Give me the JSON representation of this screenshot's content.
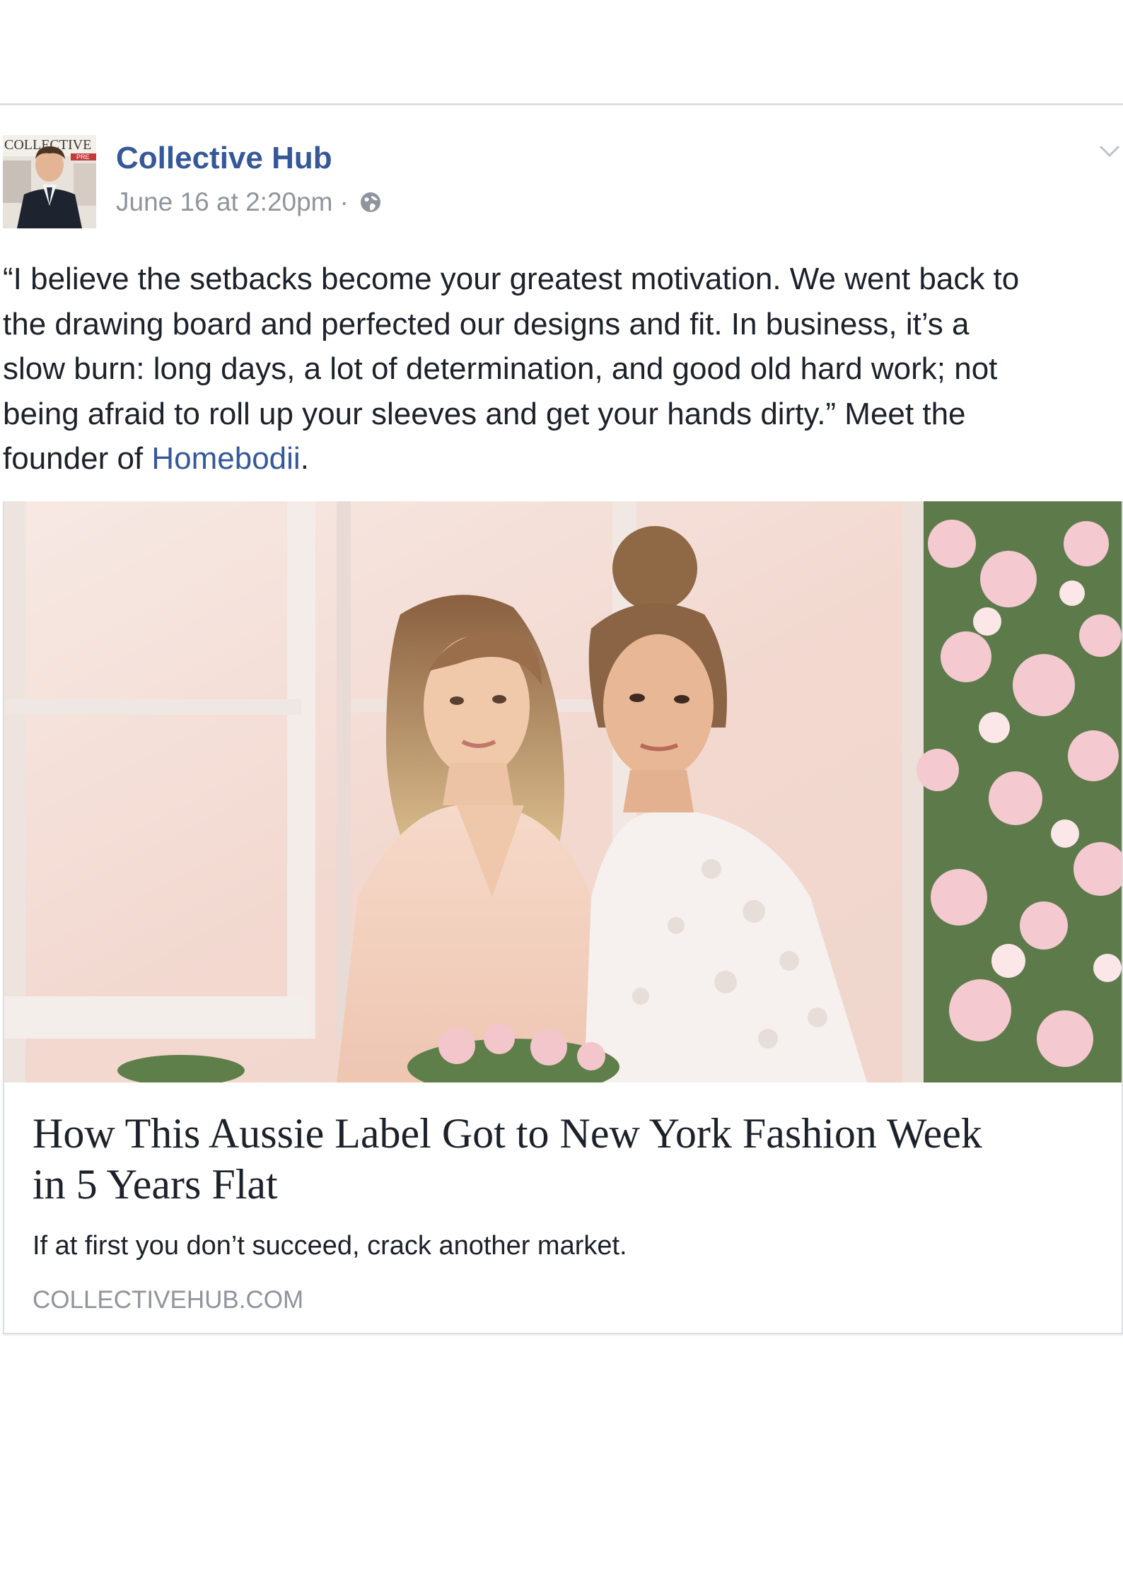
{
  "post": {
    "page_name": "Collective Hub",
    "timestamp": "June 16 at 2:20pm",
    "separator": "·",
    "privacy_icon": "globe-icon",
    "menu_icon": "chevron-down-icon",
    "avatar_alt_text": [
      "COLLECTIVE",
      "PRE"
    ],
    "text_lines": [
      "“I believe the setbacks become your greatest motivation. We went back to",
      "the drawing board and perfected our designs and fit. In business, it’s a",
      "slow burn: long days, a lot of determination, and good old hard work; not",
      "being afraid to roll up your sleeves and get your hands dirty.” Meet the"
    ],
    "last_line_prefix": "founder of ",
    "mention": "Homebodii",
    "last_line_suffix": "."
  },
  "link_preview": {
    "title_line1": "How This Aussie Label Got to New York Fashion Week",
    "title_line2": "in 5 Years Flat",
    "description": "If at first you don’t succeed, crack another market.",
    "domain": "COLLECTIVEHUB.COM"
  },
  "colors": {
    "link_blue": "#365899",
    "meta_gray": "#90949c",
    "text_dark": "#1d2129",
    "border_gray": "#dddfe2"
  }
}
